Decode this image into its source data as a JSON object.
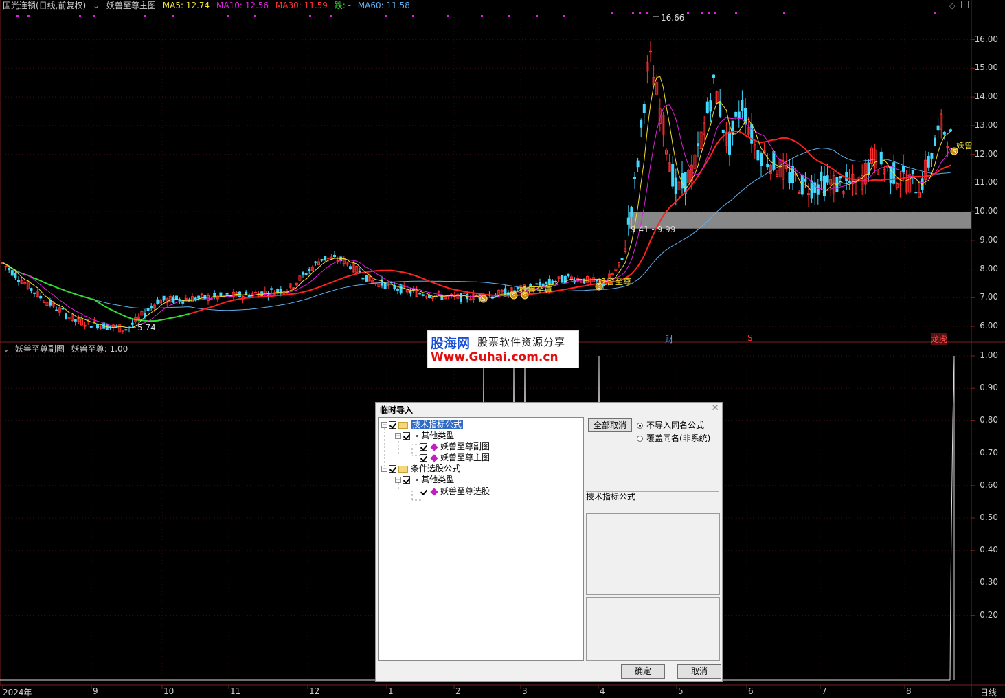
{
  "header": {
    "stock": "国光连锁(日线,前复权)",
    "indicator": "妖兽至尊主图",
    "ma5": "MA5: 12.74",
    "ma10": "MA10: 12.56",
    "ma30": "MA30: 11.59",
    "die": "跌: -",
    "ma60": "MA60: 11.58"
  },
  "sub_header": {
    "indicator": "妖兽至尊副图",
    "value": "妖兽至尊: 1.00"
  },
  "colors": {
    "ma5": "#f0e030",
    "ma10": "#e020e0",
    "ma30": "#ff2020",
    "ma60": "#60b0f0",
    "ma_green": "#30e030",
    "up": "#ff3030",
    "down": "#40d8ff"
  },
  "annotations": {
    "high_label": "16.66",
    "low_label": "5.74",
    "zone_label": "9.41 - 9.99",
    "signal_text": "妖兽至尊",
    "signal_text_last": "妖兽",
    "coin": "S",
    "event_cai": "财",
    "event_s": "S",
    "event_longhu": "龙虎"
  },
  "chart_data": [
    {
      "type": "candlestick",
      "title": "妖兽至尊主图",
      "y_ticks": [
        "16.00",
        "15.00",
        "14.00",
        "13.00",
        "12.00",
        "11.00",
        "10.00",
        "9.00",
        "8.00",
        "7.00",
        "6.00"
      ],
      "ylim": [
        5.5,
        16.9
      ],
      "x_ticks": [
        "2024年",
        "9",
        "10",
        "11",
        "12",
        "1",
        "2",
        "3",
        "4",
        "5",
        "6",
        "7",
        "8"
      ],
      "period_label": "日线",
      "series": [
        {
          "name": "MA5",
          "value": 12.74
        },
        {
          "name": "MA10",
          "value": 12.56
        },
        {
          "name": "MA30",
          "value": 11.59
        },
        {
          "name": "MA60",
          "value": 11.58
        }
      ],
      "zone": [
        9.41,
        9.99
      ],
      "high": 16.66,
      "low": 5.74
    },
    {
      "type": "line",
      "title": "妖兽至尊副图",
      "y_ticks": [
        "1.00",
        "0.90",
        "0.80",
        "0.70",
        "0.60",
        "0.50",
        "0.40",
        "0.30",
        "0.20"
      ],
      "ylim": [
        0,
        1.0
      ]
    }
  ],
  "watermark": {
    "logo": "股海网",
    "subtitle": "股票软件资源分享",
    "url": "Www.Guhai.com.cn"
  },
  "dialog": {
    "title": "临时导入",
    "tree": [
      {
        "label": "技术指标公式"
      },
      {
        "label": "其他类型"
      },
      {
        "label": "妖兽至尊副图"
      },
      {
        "label": "妖兽至尊主图"
      },
      {
        "label": "条件选股公式"
      },
      {
        "label": "其他类型"
      },
      {
        "label": "妖兽至尊选股"
      }
    ],
    "cancel_all": "全部取消",
    "option1": "不导入同名公式",
    "option2": "覆盖同名(非系统)",
    "info": "技术指标公式",
    "ok": "确定",
    "cancel": "取消"
  }
}
